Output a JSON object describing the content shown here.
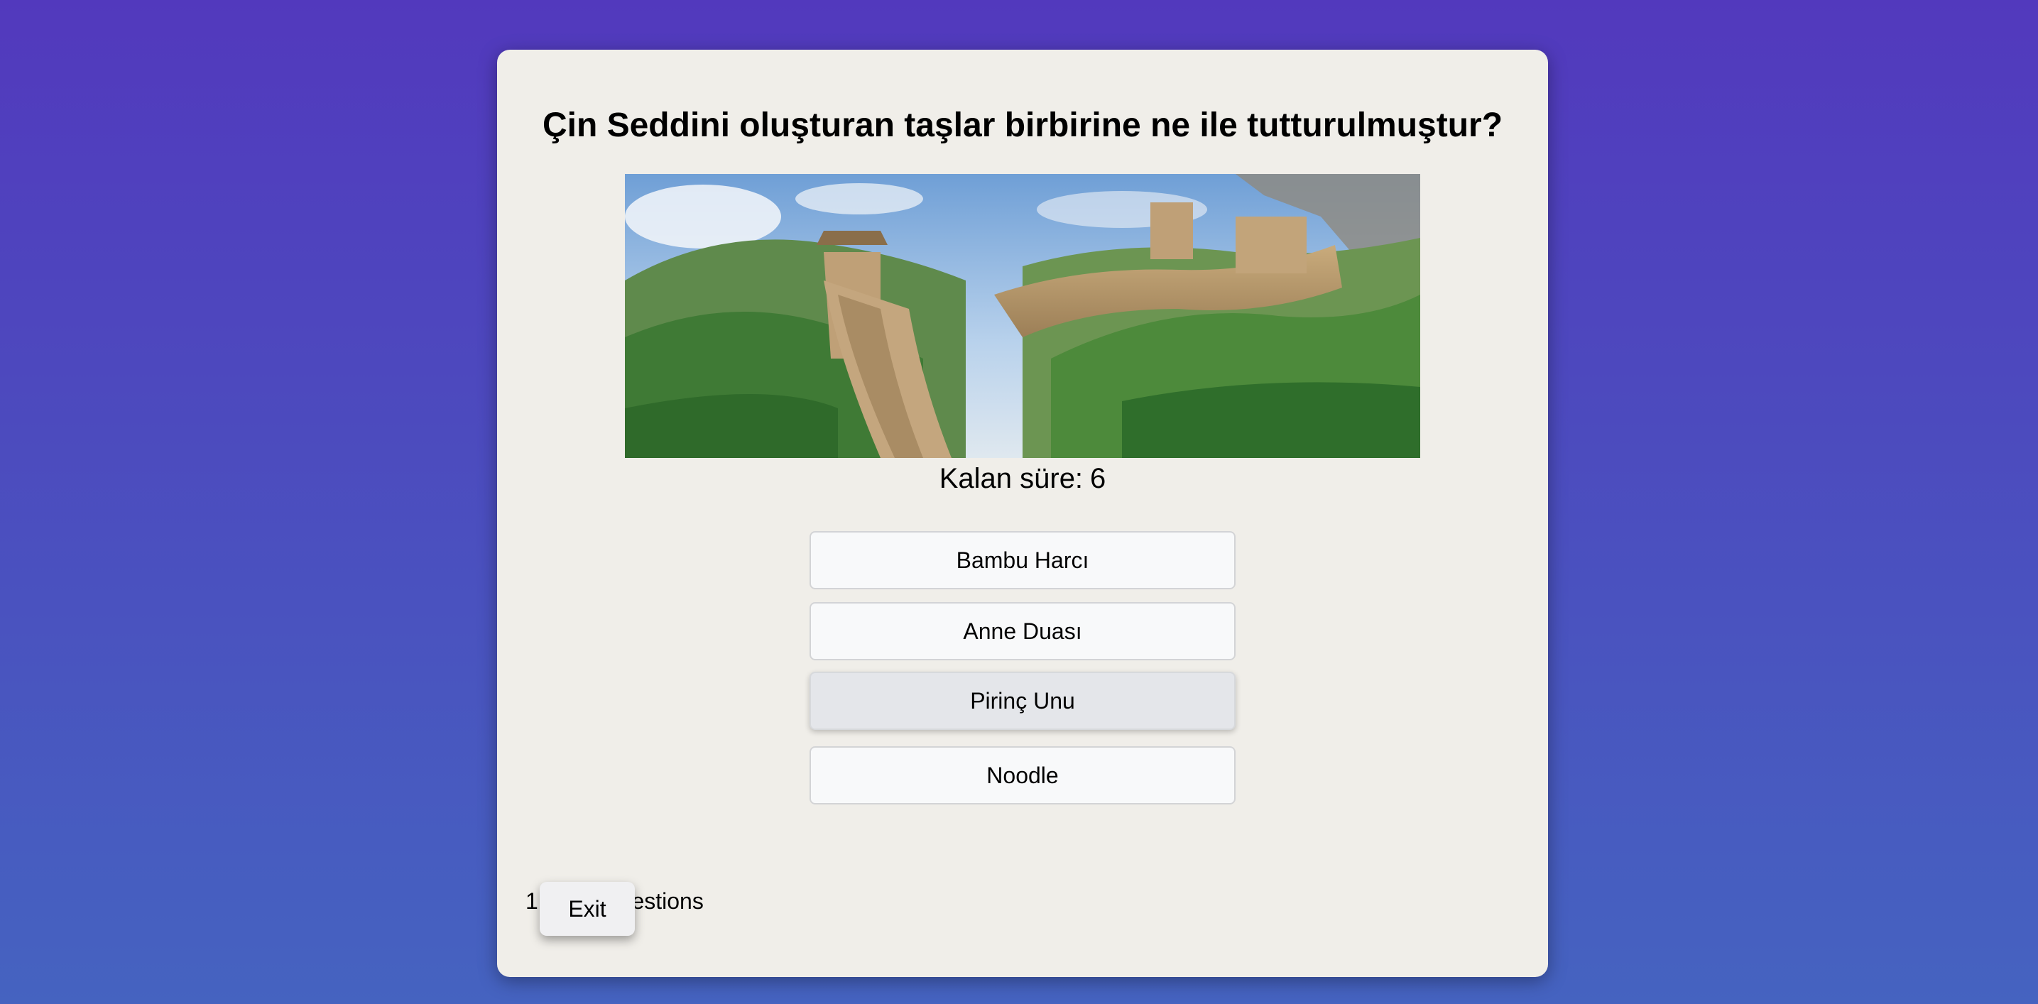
{
  "quiz": {
    "question": "Çin Seddini oluşturan taşlar birbirine ne ile tutturulmuştur?",
    "image_subject": "great-wall-photo",
    "timer_label": "Kalan süre:",
    "timer_value": "6",
    "options": [
      {
        "label": "Bambu Harcı"
      },
      {
        "label": "Anne Duası"
      },
      {
        "label": "Pirinç Unu"
      },
      {
        "label": "Noodle"
      }
    ],
    "progress_text": "1 of 10 Questions",
    "exit_label": "Exit"
  },
  "colors": {
    "background_top": "#5239bd",
    "background_bottom": "#4563c0",
    "card": "#f0eee9",
    "option_bg": "#f8f9fa",
    "option_hover_bg": "#e4e6ea"
  }
}
